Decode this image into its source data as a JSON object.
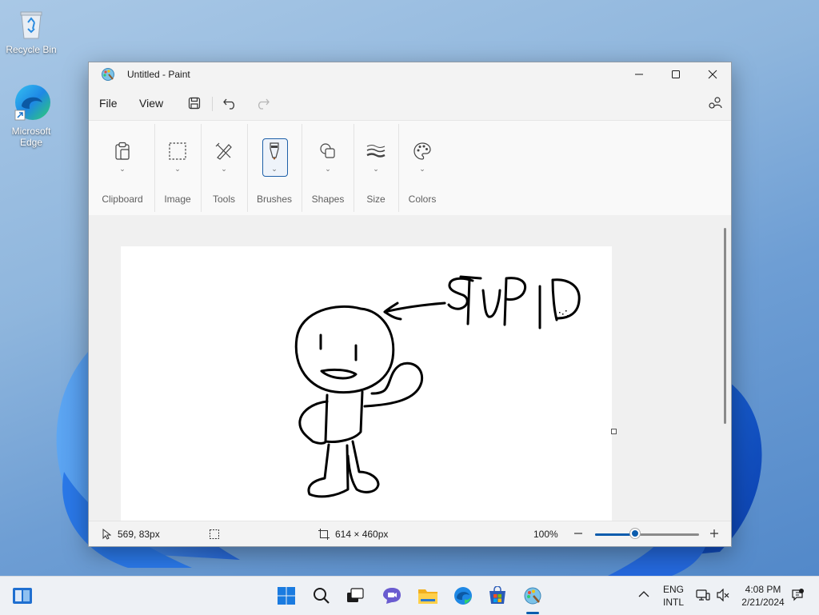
{
  "desktop": {
    "icons": [
      {
        "label": "Recycle Bin",
        "icon": "recycle-bin-icon"
      },
      {
        "label": "Microsoft Edge",
        "icon": "edge-icon"
      }
    ]
  },
  "window": {
    "title": "Untitled - Paint",
    "menu": {
      "file": "File",
      "view": "View"
    },
    "ribbon_groups": [
      "Clipboard",
      "Image",
      "Tools",
      "Brushes",
      "Shapes",
      "Size",
      "Colors"
    ],
    "status": {
      "cursor_pos": "569, 83px",
      "canvas_size": "614 × 460px",
      "zoom": "100%",
      "zoom_level": 0.38
    },
    "canvas": {
      "drawing": "stick figure pointing with arrow at handwritten text",
      "handwritten_text": "STUPID"
    }
  },
  "taskbar": {
    "apps": [
      "start",
      "search",
      "task-view",
      "teams",
      "file-explorer",
      "edge",
      "store",
      "paint"
    ],
    "language_top": "ENG",
    "language_bottom": "INTL",
    "time": "4:08 PM",
    "date": "2/21/2024"
  },
  "colors": {
    "accent": "#0b5cad",
    "window_bg": "#f3f3f3",
    "canvas_bg": "#ffffff"
  }
}
